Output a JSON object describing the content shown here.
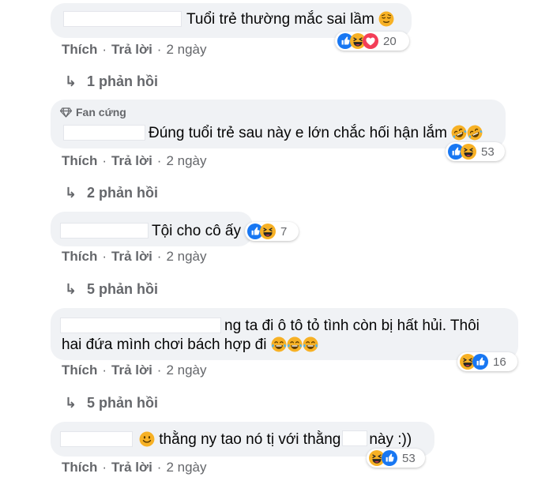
{
  "comments": [
    {
      "text": "Tuổi trẻ thường mắc sai lầm",
      "reactions": "20",
      "actions": {
        "like": "Thích",
        "reply": "Trả lời",
        "time": "2 ngày"
      },
      "replies": "1 phản hồi"
    },
    {
      "badge": "Fan cứng",
      "text": "Đúng tuổi trẻ sau này e lớn chắc hối hận lắm",
      "reactions": "53",
      "actions": {
        "like": "Thích",
        "reply": "Trả lời",
        "time": "2 ngày"
      },
      "replies": "2 phản hồi"
    },
    {
      "text": "Tội cho cô ấy",
      "reactions": "7",
      "actions": {
        "like": "Thích",
        "reply": "Trả lời",
        "time": "2 ngày"
      },
      "replies": "5 phản hồi"
    },
    {
      "text_line1": "ng ta đi ô tô tỏ tình còn bị hất hủi. Thôi",
      "text_line2": "hai đứa mình chơi bách hợp đi",
      "reactions": "16",
      "actions": {
        "like": "Thích",
        "reply": "Trả lời",
        "time": "2 ngày"
      },
      "replies": "5 phản hồi"
    },
    {
      "text_a": "thằng ny tao nó tị với thằng",
      "text_b": "này :))",
      "reactions": "53",
      "actions": {
        "like": "Thích",
        "reply": "Trả lời",
        "time": "2 ngày"
      }
    }
  ],
  "colors": {
    "bubble": "#f0f2f5",
    "meta": "#65676b",
    "like": "#1877f2",
    "haha": "#f7b125",
    "love": "#f33e58"
  }
}
